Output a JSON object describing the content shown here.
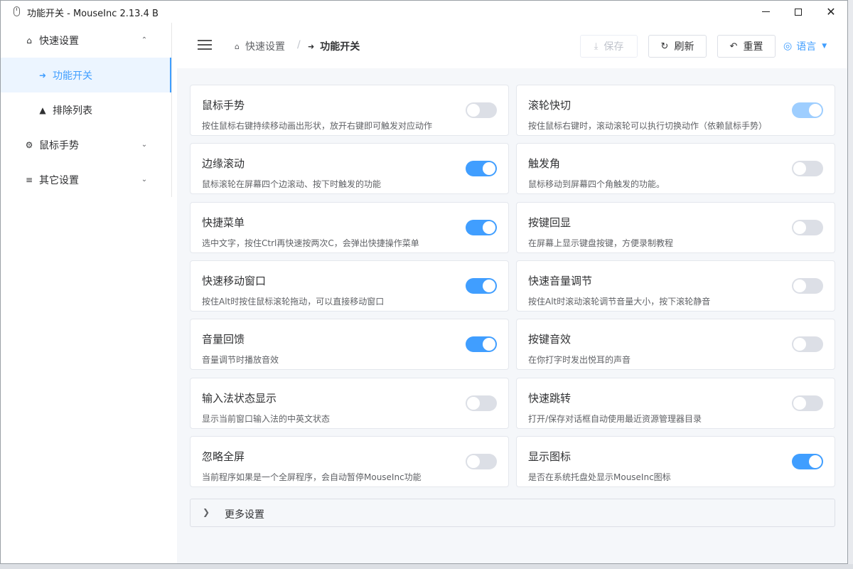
{
  "window": {
    "title": "功能开关 - MouseInc 2.13.4 B",
    "controls": {
      "minimize": "minimize",
      "maximize": "maximize",
      "close": "✕"
    }
  },
  "sidebar": {
    "items": [
      {
        "label": "快速设置",
        "icon": "home-icon",
        "expanded": true
      },
      {
        "label": "功能开关",
        "icon": "bolt-icon",
        "active": true
      },
      {
        "label": "排除列表",
        "icon": "warning-icon"
      },
      {
        "label": "鼠标手势",
        "icon": "gear-icon",
        "expanded": false
      },
      {
        "label": "其它设置",
        "icon": "sliders-icon",
        "expanded": false
      }
    ]
  },
  "header": {
    "breadcrumb": {
      "home": "快速设置",
      "separator": "/",
      "current": "功能开关"
    },
    "buttons": {
      "save": "保存",
      "refresh": "刷新",
      "reset": "重置"
    },
    "language": "语言"
  },
  "features": [
    {
      "title": "鼠标手势",
      "desc": "按住鼠标右键持续移动画出形状，放开右键即可触发对应动作",
      "enabled": false
    },
    {
      "title": "滚轮快切",
      "desc": "按住鼠标右键时，滚动滚轮可以执行切换动作（依赖鼠标手势）",
      "enabled": true,
      "disabled": true
    },
    {
      "title": "边缘滚动",
      "desc": "鼠标滚轮在屏幕四个边滚动、按下时触发的功能",
      "enabled": true
    },
    {
      "title": "触发角",
      "desc": "鼠标移动到屏幕四个角触发的功能。",
      "enabled": false
    },
    {
      "title": "快捷菜单",
      "desc": "选中文字，按住Ctrl再快速按两次C，会弹出快捷操作菜单",
      "enabled": true
    },
    {
      "title": "按键回显",
      "desc": "在屏幕上显示键盘按键，方便录制教程",
      "enabled": false
    },
    {
      "title": "快速移动窗口",
      "desc": "按住Alt时按住鼠标滚轮拖动，可以直接移动窗口",
      "enabled": true
    },
    {
      "title": "快速音量调节",
      "desc": "按住Alt时滚动滚轮调节音量大小，按下滚轮静音",
      "enabled": false
    },
    {
      "title": "音量回馈",
      "desc": "音量调节时播放音效",
      "enabled": true
    },
    {
      "title": "按键音效",
      "desc": "在你打字时发出悦耳的声音",
      "enabled": false
    },
    {
      "title": "输入法状态显示",
      "desc": "显示当前窗口输入法的中英文状态",
      "enabled": false
    },
    {
      "title": "快速跳转",
      "desc": "打开/保存对话框自动使用最近资源管理器目录",
      "enabled": false
    },
    {
      "title": "忽略全屏",
      "desc": "当前程序如果是一个全屏程序，会自动暂停MouseInc功能",
      "enabled": false
    },
    {
      "title": "显示图标",
      "desc": "是否在系统托盘处显示MouseInc图标",
      "enabled": true
    }
  ],
  "more_settings": {
    "label": "更多设置"
  },
  "colors": {
    "accent": "#409eff",
    "active_bg": "#ecf5ff",
    "toggle_off": "#dcdfe6"
  }
}
